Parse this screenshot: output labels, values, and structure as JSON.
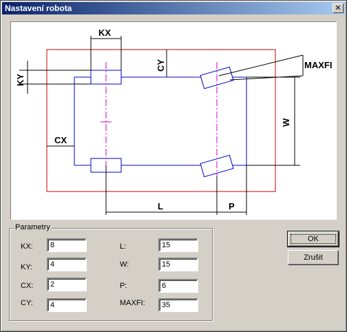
{
  "window": {
    "title": "Nastavení robota",
    "close_glyph": "✕"
  },
  "diagram": {
    "labels": {
      "kx": "KX",
      "ky": "KY",
      "cy": "CY",
      "cx": "CX",
      "maxfi": "MAXFI",
      "w": "W",
      "l": "L",
      "p": "P"
    },
    "colors": {
      "outline": "#cc0000",
      "body": "#0000cc",
      "axis": "#cc00cc",
      "dim": "#000000"
    }
  },
  "params": {
    "legend": "Parametry",
    "kx": {
      "label": "KX:",
      "value": "8"
    },
    "ky": {
      "label": "KY:",
      "value": "4"
    },
    "cx": {
      "label": "CX:",
      "value": "2"
    },
    "cy": {
      "label": "CY:",
      "value": "4"
    },
    "l": {
      "label": "L:",
      "value": "15"
    },
    "w": {
      "label": "W:",
      "value": "15"
    },
    "p": {
      "label": "P:",
      "value": "6"
    },
    "maxfi": {
      "label": "MAXFI:",
      "value": "35"
    }
  },
  "buttons": {
    "ok": "OK",
    "cancel": "Zrušit"
  }
}
